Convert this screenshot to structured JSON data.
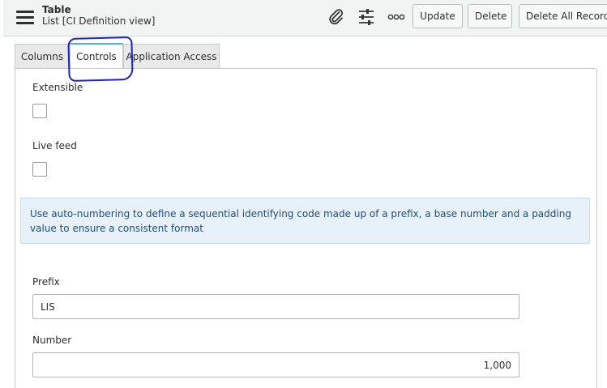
{
  "header": {
    "title": "Table",
    "subtitle": "List [CI Definition view]",
    "icons": [
      "attachment-icon",
      "settings-sliders-icon",
      "more-options-icon"
    ],
    "buttons": {
      "update": "Update",
      "delete": "Delete",
      "delete_all": "Delete All Records"
    }
  },
  "tabs": [
    {
      "label": "Columns",
      "active": false
    },
    {
      "label": "Controls",
      "active": true
    },
    {
      "label": "Application Access",
      "active": false
    }
  ],
  "form": {
    "extensible": {
      "label": "Extensible",
      "checked": false
    },
    "live_feed": {
      "label": "Live feed",
      "checked": false
    },
    "info_message": "Use auto-numbering to define a sequential identifying code made up of a prefix, a base number and a padding value to ensure a consistent format",
    "prefix": {
      "label": "Prefix",
      "value": "LIS"
    },
    "number": {
      "label": "Number",
      "value": "1,000"
    }
  },
  "colors": {
    "header_bg": "#f2f3f3",
    "active_tab_accent": "#49b6d8",
    "info_bg": "#e6f1fa",
    "info_text": "#1f4e79",
    "annotation": "#1a24c8"
  }
}
